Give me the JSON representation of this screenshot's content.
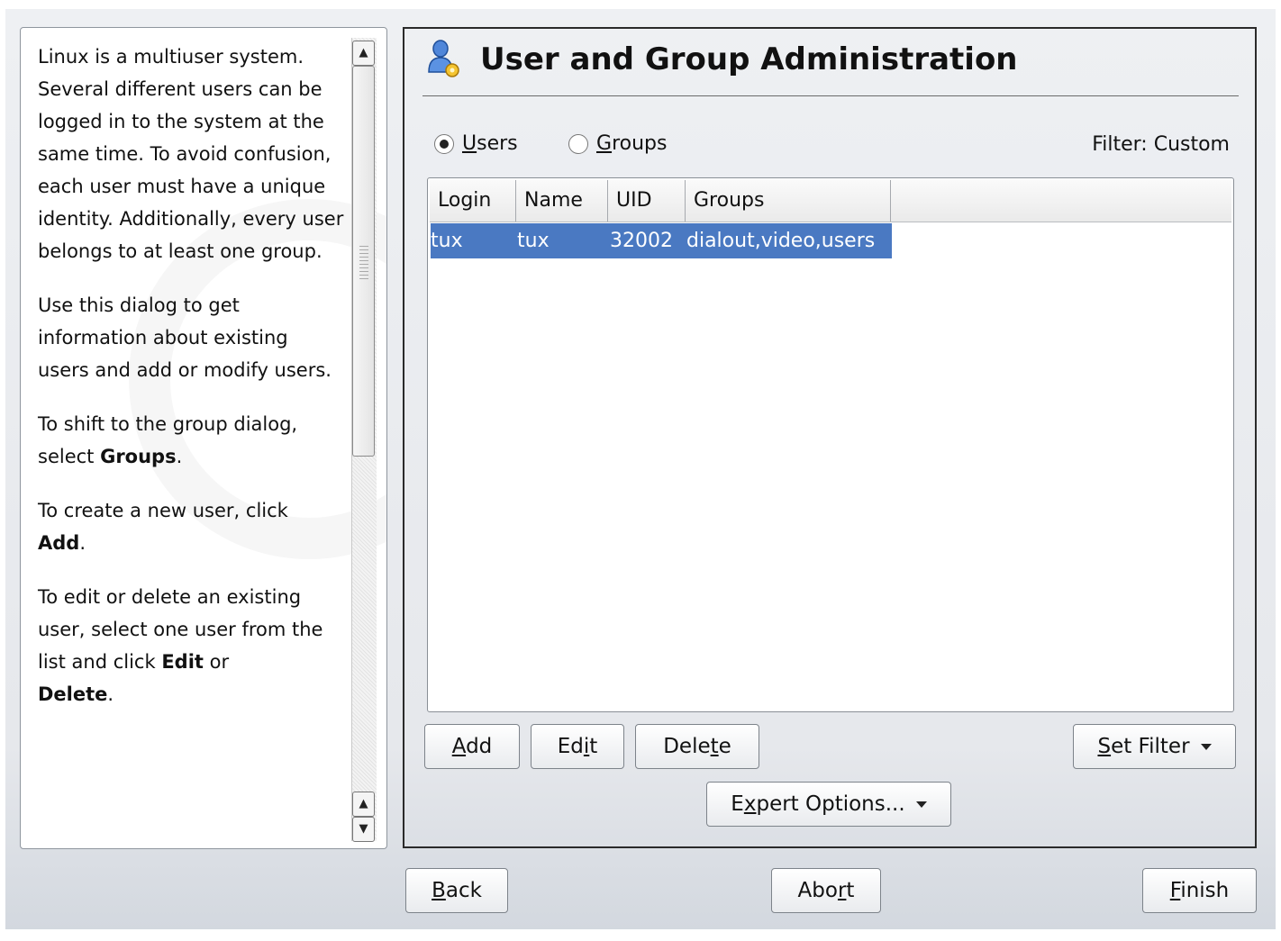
{
  "help": {
    "p1": "Linux is a multiuser system. Several different users can be logged in to the system at the same time. To avoid confusion, each user must have a unique identity. Additionally, every user belongs to at least one group.",
    "p2": "Use this dialog to get information about existing users and add or modify users.",
    "p3_prefix": "To shift to the group dialog, select ",
    "p3_bold": "Groups",
    "p3_suffix": ".",
    "p4_prefix": "To create a new user, click ",
    "p4_bold": "Add",
    "p4_suffix": ".",
    "p5_prefix": "To edit or delete an existing user, select one user from the list and click ",
    "p5_bold1": "Edit",
    "p5_mid": " or ",
    "p5_bold2": "Delete",
    "p5_suffix": ".",
    "scroll_up_glyph": "▲",
    "scroll_down_glyph": "▼"
  },
  "header": {
    "title": "User and Group Administration",
    "icon": "user-admin-icon"
  },
  "view_toggle": {
    "users_pre": "",
    "users_u": "U",
    "users_post": "sers",
    "groups_pre": "",
    "groups_u": "G",
    "groups_post": "roups",
    "selected": "users"
  },
  "filter": {
    "label": "Filter: Custom"
  },
  "table": {
    "columns": [
      "Login",
      "Name",
      "UID",
      "Groups"
    ],
    "rows": [
      {
        "login": "tux",
        "name": "tux",
        "uid": "32002",
        "groups": "dialout,video,users"
      }
    ],
    "selection_color": "#4a79c2"
  },
  "actions": {
    "add_u": "A",
    "add_post": "dd",
    "edit_pre": "Ed",
    "edit_u": "i",
    "edit_post": "t",
    "delete_pre": "Dele",
    "delete_u": "t",
    "delete_post": "e",
    "set_filter_u": "S",
    "set_filter_post": "et Filter",
    "expert_pre": "E",
    "expert_u": "x",
    "expert_post": "pert Options..."
  },
  "nav": {
    "back_u": "B",
    "back_post": "ack",
    "abort_pre": "Abo",
    "abort_u": "r",
    "abort_post": "t",
    "finish_u": "F",
    "finish_post": "inish"
  }
}
